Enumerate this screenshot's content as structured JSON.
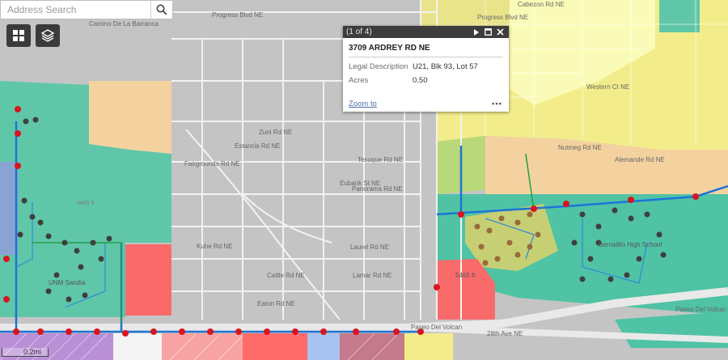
{
  "search": {
    "placeholder": "Address Search"
  },
  "map": {
    "street_labels": [
      "Progress Blvd NE",
      "Progress Blvd NE",
      "Cabezon Rd NE",
      "Camino De La Barranca",
      "Tesuque Rd NE",
      "Zuni Rd NE",
      "Estancia Rd NE",
      "Fairgrounds Rd NE",
      "Eubank St NE",
      "Panorama Rd NE",
      "Kuhe Rd NE",
      "Laurel Rd NE",
      "Lamar Rd NE",
      "Cattle Rd NE",
      "Eaton Rd NE",
      "Paseo Del Volcan",
      "Paseo Del Volcan",
      "28th Ave NE",
      "Alemande Rd NE",
      "Nutmeg Rd NE",
      "Western Ct NE"
    ],
    "place_labels": [
      "UNM Sandia",
      "Bernalillo High School"
    ],
    "elevation_labels": [
      "5465 ft",
      "5485 ft"
    ],
    "scale_label": "0.2mi"
  },
  "popup": {
    "counter": "(1 of 4)",
    "title": "3709 ARDREY RD NE",
    "attributes": [
      {
        "label": "Legal Description",
        "value": "U21, Blk 93, Lot 57"
      },
      {
        "label": "Acres",
        "value": "0.50"
      }
    ],
    "zoom_label": "Zoom to",
    "more_label": "•••"
  },
  "colors": {
    "residential": "#fbfba0",
    "commercial": "#f3d2a0",
    "open_space": "#3cbfa0",
    "public": "#fc6b6b",
    "water_line": "#1e74d6",
    "hydrant": "#d8151f",
    "panel": "#3d3d3d"
  }
}
